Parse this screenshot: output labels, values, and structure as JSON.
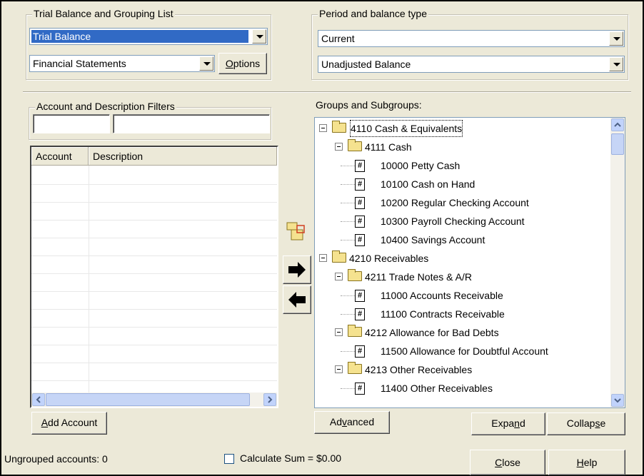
{
  "trial_balance_group": {
    "title": "Trial Balance and Grouping List",
    "list_value": "Trial Balance",
    "statement_value": "Financial Statements",
    "options_button": {
      "pre": "",
      "key": "O",
      "post": "ptions"
    }
  },
  "period_group": {
    "title": "Period and balance type",
    "period_value": "Current",
    "balance_value": "Unadjusted Balance"
  },
  "filters": {
    "title": "Account and Description Filters",
    "account_value": "",
    "description_value": ""
  },
  "accounts_list": {
    "columns": [
      "Account",
      "Description"
    ],
    "rows": []
  },
  "groups_label": "Groups and Subgroups:",
  "tree": [
    {
      "level": 0,
      "type": "folder",
      "label": "4110  Cash & Equivalents"
    },
    {
      "level": 1,
      "type": "folder",
      "label": "4111  Cash"
    },
    {
      "level": 2,
      "type": "account",
      "label": "10000  Petty Cash"
    },
    {
      "level": 2,
      "type": "account",
      "label": "10100  Cash on Hand"
    },
    {
      "level": 2,
      "type": "account",
      "label": "10200  Regular Checking Account"
    },
    {
      "level": 2,
      "type": "account",
      "label": "10300  Payroll Checking Account"
    },
    {
      "level": 2,
      "type": "account",
      "label": "10400  Savings Account"
    },
    {
      "level": 0,
      "type": "folder",
      "label": "4210  Receivables"
    },
    {
      "level": 1,
      "type": "folder",
      "label": "4211  Trade Notes & A/R"
    },
    {
      "level": 2,
      "type": "account",
      "label": "11000  Accounts Receivable"
    },
    {
      "level": 2,
      "type": "account",
      "label": "11100  Contracts Receivable"
    },
    {
      "level": 1,
      "type": "folder",
      "label": "4212  Allowance for Bad Debts"
    },
    {
      "level": 2,
      "type": "account",
      "label": "11500  Allowance for Doubtful Account"
    },
    {
      "level": 1,
      "type": "folder",
      "label": "4213  Other Receivables"
    },
    {
      "level": 2,
      "type": "account",
      "label": "11400  Other Receivables"
    }
  ],
  "buttons": {
    "add_account": {
      "pre": "",
      "key": "A",
      "post": "dd Account"
    },
    "advanced": {
      "pre": "Ad",
      "key": "v",
      "post": "anced"
    },
    "expand": {
      "pre": "Expa",
      "key": "n",
      "post": "d"
    },
    "collapse": {
      "pre": "Collap",
      "key": "s",
      "post": "e"
    },
    "close": {
      "pre": "",
      "key": "C",
      "post": "lose"
    },
    "help": {
      "pre": "",
      "key": "H",
      "post": "elp"
    }
  },
  "status": {
    "ungrouped": "Ungrouped accounts: 0",
    "calculate_sum": "Calculate Sum = $0.00",
    "calculate_checked": false
  },
  "icons": {
    "move_right": "arrow-right-icon",
    "move_left": "arrow-left-icon",
    "new_group": "folder-new-icon"
  }
}
